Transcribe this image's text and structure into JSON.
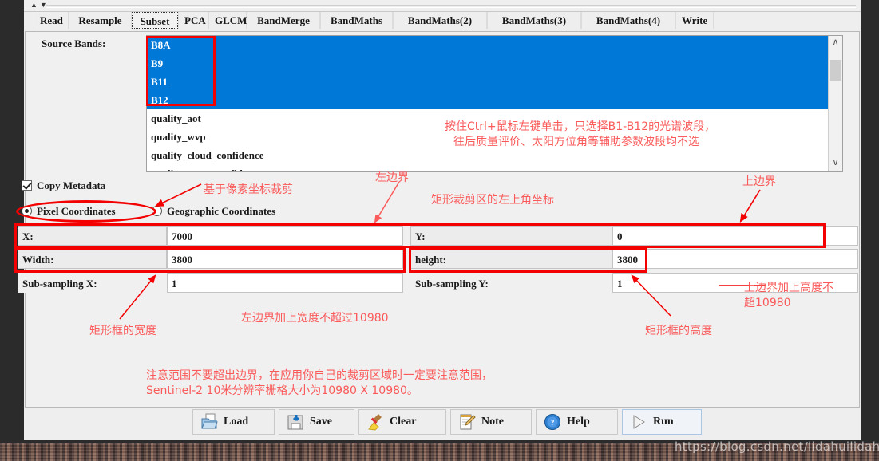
{
  "window": {
    "watermark": "https://blog.csdn.net/lidahuilidahui"
  },
  "tabs": [
    {
      "label": "Read",
      "active": false
    },
    {
      "label": "Resample",
      "active": false
    },
    {
      "label": "Subset",
      "active": true
    },
    {
      "label": "PCA",
      "active": false
    },
    {
      "label": "GLCM",
      "active": false
    },
    {
      "label": "BandMerge",
      "active": false
    },
    {
      "label": "BandMaths",
      "active": false
    },
    {
      "label": "BandMaths(2)",
      "active": false
    },
    {
      "label": "BandMaths(3)",
      "active": false
    },
    {
      "label": "BandMaths(4)",
      "active": false
    },
    {
      "label": "Write",
      "active": false
    }
  ],
  "form": {
    "source_bands_label": "Source Bands:",
    "bands": [
      {
        "name": "B8A",
        "selected": true
      },
      {
        "name": "B9",
        "selected": true
      },
      {
        "name": "B11",
        "selected": true
      },
      {
        "name": "B12",
        "selected": true
      },
      {
        "name": "quality_aot",
        "selected": false
      },
      {
        "name": "quality_wvp",
        "selected": false
      },
      {
        "name": "quality_cloud_confidence",
        "selected": false
      },
      {
        "name": "quality_snow_confidence",
        "selected": false
      }
    ],
    "copy_metadata_label": "Copy Metadata",
    "copy_metadata_checked": true,
    "pixel_coordinates_label": "Pixel Coordinates",
    "geographic_coordinates_label": "Geographic Coordinates",
    "coordinate_mode": "Pixel Coordinates",
    "fields": [
      {
        "label": "X:",
        "value": "7000"
      },
      {
        "label": "Y:",
        "value": "0"
      },
      {
        "label": "Width:",
        "value": "3800"
      },
      {
        "label": "height:",
        "value": "3800"
      },
      {
        "label": "Sub-sampling X:",
        "value": "1"
      },
      {
        "label": "Sub-sampling Y:",
        "value": "1"
      }
    ]
  },
  "annotations": {
    "bands_hint_line1": "按住Ctrl+鼠标左键单击，只选择B1-B12的光谱波段，",
    "bands_hint_line2": "往后质量评价、太阳方位角等辅助参数波段均不选",
    "pixel_coord_hint": "基于像素坐标裁剪",
    "left_border": "左边界",
    "top_left_corner": "矩形裁剪区的左上角坐标",
    "top_border": "上边界",
    "rect_width": "矩形框的宽度",
    "rect_height": "矩形框的高度",
    "left_plus_width": "左边界加上宽度不超过10980",
    "top_plus_height_line1": "上边界加上高度不",
    "top_plus_height_line2": "超10980",
    "footer_line1": "注意范围不要超出边界，在应用你自己的裁剪区域时一定要注意范围，",
    "footer_line2": "Sentinel-2 10米分辨率栅格大小为10980 X 10980。"
  },
  "buttons": [
    {
      "label": "Load",
      "icon": "folder-open-icon"
    },
    {
      "label": "Save",
      "icon": "floppy-save-icon"
    },
    {
      "label": "Clear",
      "icon": "broom-icon"
    },
    {
      "label": "Note",
      "icon": "notepad-pencil-icon"
    },
    {
      "label": "Help",
      "icon": "question-circle-icon"
    },
    {
      "label": "Run",
      "icon": "play-triangle-icon"
    }
  ],
  "colors": {
    "selection_blue": "#0078d7",
    "annotation_red": "#f30000",
    "annotation_text_red": "#fa5a5a",
    "panel_gray": "#eeeeee"
  }
}
